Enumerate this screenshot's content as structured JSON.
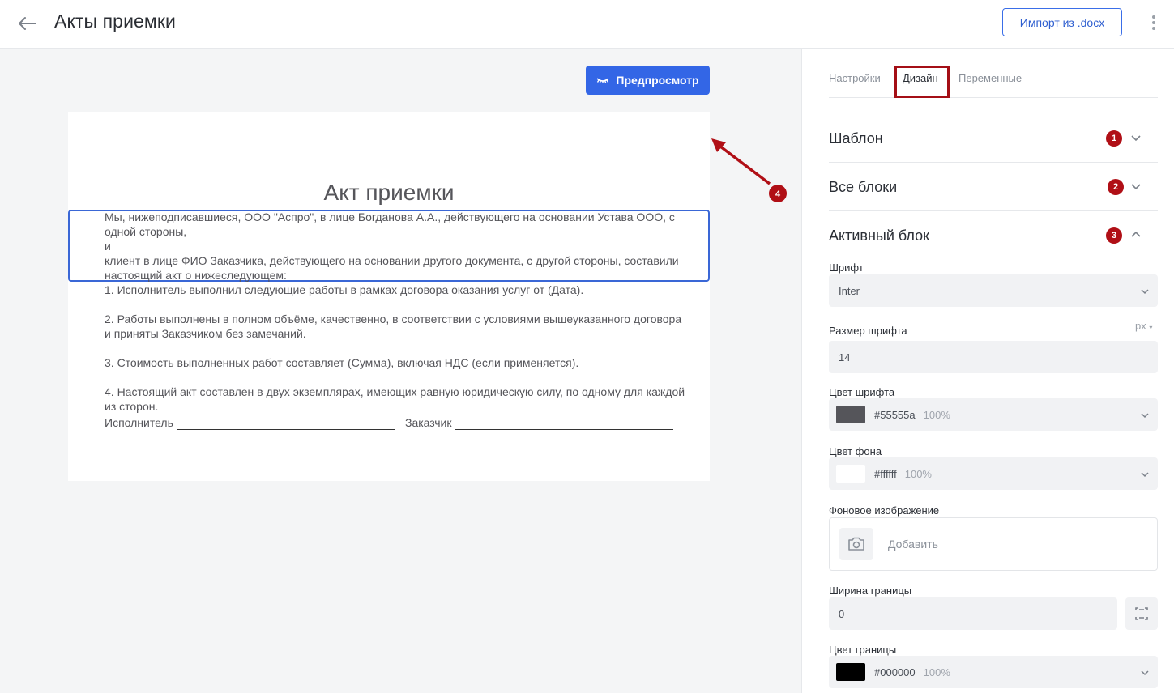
{
  "header": {
    "title": "Акты приемки",
    "import_label": "Импорт из .docx"
  },
  "canvas": {
    "preview_label": "Предпросмотр",
    "annotation_badge": "4",
    "document": {
      "title": "Акт приемки",
      "paragraphs": [
        "Мы, нижеподписавшиеся, ООО \"Аспро\", в лице Богданова А.А., действующего на основании Устава ООО, с одной стороны,",
        "и",
        "клиент в лице ФИО Заказчика, действующего на основании другого документа, с другой стороны, составили настоящий акт о нижеследующем:",
        "1. Исполнитель выполнил следующие работы в рамках договора оказания услуг от (Дата).",
        "2. Работы выполнены в полном объёме, качественно, в соответствии с условиями вышеуказанного договора и приняты Заказчиком без замечаний.",
        "3. Стоимость выполненных работ составляет (Сумма), включая НДС (если применяется).",
        "4. Настоящий акт составлен в двух экземплярах, имеющих равную юридическую силу, по одному для каждой из сторон."
      ],
      "signature_executor": "Исполнитель",
      "signature_customer": "Заказчик"
    }
  },
  "panel": {
    "tabs": [
      "Настройки",
      "Дизайн",
      "Переменные"
    ],
    "active_tab": "Дизайн",
    "sections": [
      {
        "title": "Шаблон",
        "badge": "1"
      },
      {
        "title": "Все блоки",
        "badge": "2"
      },
      {
        "title": "Активный блок",
        "badge": "3"
      }
    ],
    "font_label": "Шрифт",
    "font_value": "Inter",
    "font_size_label": "Размер шрифта",
    "font_size_unit": "px",
    "font_size_value": "14",
    "font_color_label": "Цвет шрифта",
    "font_color_value": "#55555a",
    "font_color_opacity": "100%",
    "bg_color_label": "Цвет фона",
    "bg_color_value": "#ffffff",
    "bg_color_opacity": "100%",
    "bg_image_label": "Фоновое изображение",
    "bg_image_add": "Добавить",
    "border_width_label": "Ширина границы",
    "border_width_value": "0",
    "border_color_label": "Цвет границы",
    "border_color_value": "#000000",
    "border_color_opacity": "100%"
  },
  "colors": {
    "accent": "#3366e6",
    "annotation": "#b00f16",
    "font_swatch": "#55555a",
    "bg_swatch": "#ffffff",
    "border_swatch": "#000000"
  }
}
